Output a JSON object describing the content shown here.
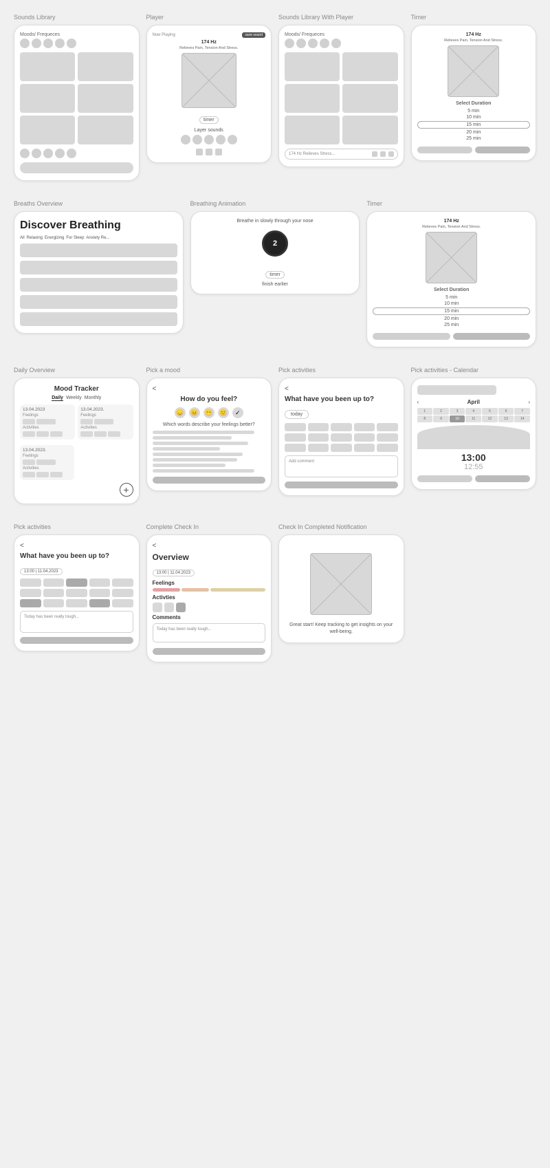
{
  "sections": {
    "row1": {
      "labels": [
        "Sounds Library",
        "Player",
        "Sounds Library With Player",
        "Timer"
      ],
      "phones": [
        {
          "id": "sounds-library",
          "title": "Moods/ Frequeces"
        },
        {
          "id": "player",
          "now_playing": "Now Playing",
          "save_btn": "save sound",
          "freq": "174 Hz",
          "desc": "Relieves Pain, Tension And Stress.",
          "timer_btn": "timer",
          "layer_sounds": "Layer sounds"
        },
        {
          "id": "sounds-library-with-player",
          "title": "Moods/ Frequeces",
          "bottom_bar": "174 Hz Relieves Stress..."
        },
        {
          "id": "timer",
          "freq": "174 Hz",
          "desc": "Relieves Pain, Tension And Stress.",
          "select_duration": "Select Duration",
          "options": [
            "5 min",
            "10 min",
            "15 min",
            "20 min",
            "25 min"
          ],
          "selected": "15 min"
        }
      ]
    },
    "row2": {
      "labels": [
        "Breaths Overview",
        "Breathing Animation",
        "Timer"
      ],
      "phones": [
        {
          "id": "breaths-overview",
          "title": "Discover Breathing",
          "filters": [
            "All",
            "Relaxing",
            "Energizing",
            "For Sleep",
            "Anxiety Re..."
          ]
        },
        {
          "id": "breathing-animation",
          "instruction": "Breathe in slowly through your nose",
          "count": "2",
          "timer_btn": "timer",
          "finish_label": "finish earlier"
        },
        {
          "id": "timer2",
          "freq": "174 Hz",
          "desc": "Relieves Pain, Tension And Stress.",
          "select_duration": "Select Duration",
          "options": [
            "5 min",
            "10 min",
            "15 min",
            "20 min",
            "25 min"
          ],
          "selected": "15 min"
        }
      ]
    },
    "row3": {
      "labels": [
        "Daily Overview",
        "Pick a mood",
        "Pick activities",
        "Pick activities - Calendar"
      ],
      "phones": [
        {
          "id": "daily-overview",
          "title": "Mood Tracker",
          "tabs": [
            "Daily",
            "Weekly",
            "Monthly"
          ],
          "active_tab": "Daily",
          "dates": [
            "13.04.2023",
            "13.04.2023.",
            "13.04.2023."
          ],
          "feelings_label": "Feelings",
          "activities_label": "Activities",
          "add_btn": "+"
        },
        {
          "id": "pick-mood",
          "back": "<",
          "title": "How do you feel?",
          "subtitle": "Which words describe your feelings better?"
        },
        {
          "id": "pick-activities",
          "back": "<",
          "title": "What have you been up to?",
          "today_btn": "today",
          "add_comment": "Add comment"
        },
        {
          "id": "pick-activities-calendar",
          "back": "<",
          "month": "April",
          "time1": "13:00",
          "time2": "12:55"
        }
      ]
    },
    "row4": {
      "labels": [
        "Pick activities",
        "Complete Check In",
        "Check In Completed Notification"
      ],
      "phones": [
        {
          "id": "pick-activities-2",
          "back": "<",
          "title": "What have you been up to?",
          "date_label": "13:00 | 11.04.2023",
          "comment_placeholder": "Today has been really tough..."
        },
        {
          "id": "complete-check-in",
          "back": "<",
          "title": "Overview",
          "date_label": "13:00 | 11.04.2023",
          "feelings_label": "Feelings",
          "activities_label": "Activties",
          "comments_label": "Comments",
          "comment_text": "Today has been really tough..."
        },
        {
          "id": "check-in-completed",
          "notification_text": "Great start! Keep tracking to get insights on your well-being."
        }
      ]
    }
  }
}
